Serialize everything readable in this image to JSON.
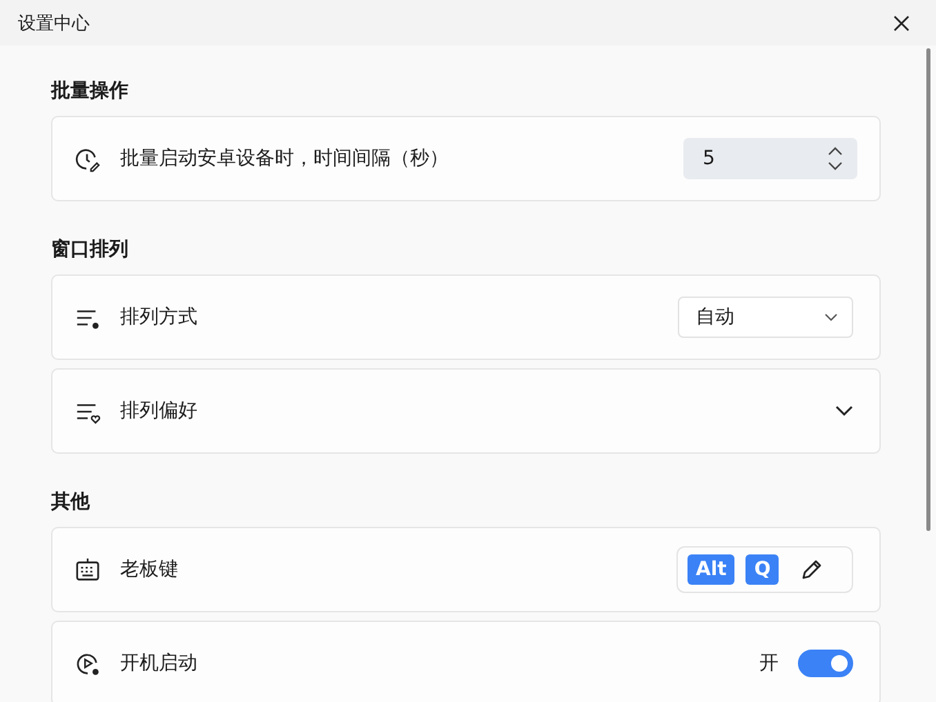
{
  "window": {
    "title": "设置中心"
  },
  "sections": [
    {
      "title": "批量操作",
      "rows": [
        {
          "kind": "spinner",
          "label": "批量启动安卓设备时，时间间隔（秒）",
          "value": "5"
        }
      ]
    },
    {
      "title": "窗口排列",
      "rows": [
        {
          "kind": "select",
          "label": "排列方式",
          "value": "自动"
        },
        {
          "kind": "expander",
          "label": "排列偏好",
          "expanded": false
        }
      ]
    },
    {
      "title": "其他",
      "rows": [
        {
          "kind": "hotkey",
          "label": "老板键",
          "keys": [
            "Alt",
            "Q"
          ]
        },
        {
          "kind": "toggle",
          "label": "开机启动",
          "state_label": "开",
          "on": true
        }
      ]
    }
  ]
}
